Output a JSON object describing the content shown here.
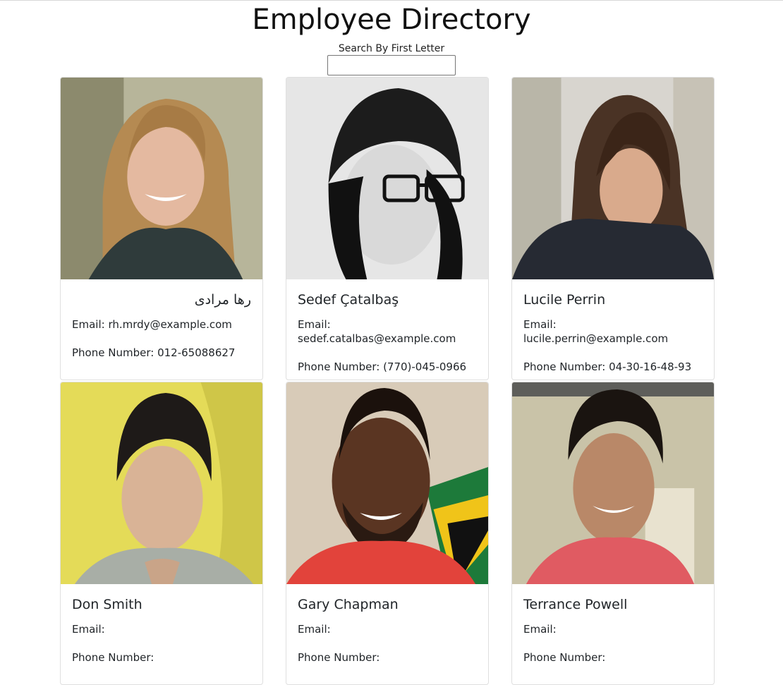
{
  "header": {
    "title": "Employee Directory",
    "search_label": "Search By First Letter",
    "search_value": ""
  },
  "labels": {
    "email": "Email: ",
    "phone": "Phone Number: "
  },
  "employees": [
    {
      "name": "رها مرادی",
      "email": "rh.mrdy@example.com",
      "phone": "012-65088627"
    },
    {
      "name": "Sedef Çatalbaş",
      "email": "sedef.catalbas@example.com",
      "phone": "(770)-045-0966"
    },
    {
      "name": "Lucile Perrin",
      "email": "lucile.perrin@example.com",
      "phone": "04-30-16-48-93"
    },
    {
      "name": "Don Smith",
      "email": "",
      "phone": ""
    },
    {
      "name": "Gary Chapman",
      "email": "",
      "phone": ""
    },
    {
      "name": "Terrance Powell",
      "email": "",
      "phone": ""
    }
  ],
  "colors": {
    "card_border": "#dfdfdf",
    "text": "#212529",
    "title": "#111111"
  }
}
